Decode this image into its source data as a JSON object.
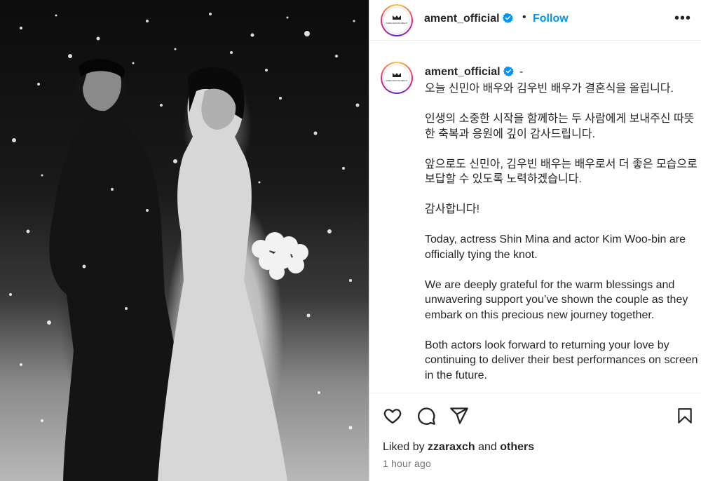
{
  "post": {
    "header": {
      "username": "ament_official",
      "separator": "•",
      "follow_label": "Follow",
      "more_label": "•••",
      "avatar_text": "AMENTERTAINMENT"
    },
    "caption": {
      "author": "ament_official",
      "dash": "-",
      "paragraphs": [
        "오늘 신민아 배우와 김우빈 배우가 결혼식을 올립니다.",
        "인생의 소중한 시작을 함께하는 두 사람에게 보내주신 따뜻한 축복과 응원에 깊이 감사드립니다.",
        "앞으로도 신민아, 김우빈 배우는 배우로서 더 좋은 모습으로 보답할 수 있도록 노력하겠습니다.",
        "감사합니다!",
        "Today, actress Shin Mina and actor Kim Woo-bin are officially tying the knot.",
        "We are deeply grateful for the warm blessings and unwavering support you’ve shown the couple as they embark on this precious new journey together.",
        "Both actors look forward to returning your love by continuing to deliver their best performances on screen in the future."
      ]
    },
    "likes": {
      "prefix": "Liked by",
      "user": "zzaraxch",
      "conjunction": "and",
      "others": "others"
    },
    "timestamp": "1 hour ago",
    "icons": {
      "like": "heart-icon",
      "comment": "comment-icon",
      "share": "share-icon",
      "save": "bookmark-icon",
      "verified": "verified-badge-icon"
    },
    "colors": {
      "follow": "#0095f6",
      "verified": "#0095f6",
      "muted": "#737373"
    }
  }
}
